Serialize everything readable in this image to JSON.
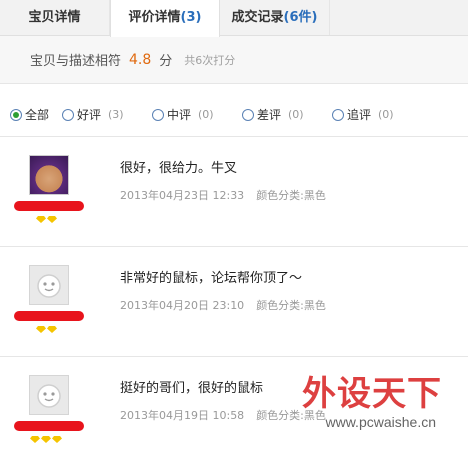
{
  "tabs": [
    {
      "label": "宝贝详情",
      "count": ""
    },
    {
      "label": "评价详情",
      "count": "3",
      "active": true
    },
    {
      "label": "成交记录",
      "count": "6件"
    }
  ],
  "summary": {
    "label": "宝贝与描述相符",
    "score": "4.8",
    "unit": "分",
    "note": "共6次打分"
  },
  "filters": [
    {
      "label": "全部",
      "count": "",
      "checked": true
    },
    {
      "label": "好评",
      "count": "(3)"
    },
    {
      "label": "中评",
      "count": "(0)"
    },
    {
      "label": "差评",
      "count": "(0)"
    },
    {
      "label": "追评",
      "count": "(0)"
    }
  ],
  "reviews": [
    {
      "text": "很好，很给力。牛叉",
      "time": "2013年04月23日 12:33",
      "attr": "颜色分类:黑色",
      "rank_gems": 2
    },
    {
      "text": "非常好的鼠标，论坛帮你顶了～",
      "time": "2013年04月20日 23:10",
      "attr": "颜色分类:黑色",
      "rank_gems": 2
    },
    {
      "text": "挺好的哥们，很好的鼠标",
      "time": "2013年04月19日 10:58",
      "attr": "颜色分类:黑色",
      "rank_gems": 3
    }
  ],
  "watermark": {
    "title": "外设天下",
    "url": "www.pcwaishe.cn"
  }
}
